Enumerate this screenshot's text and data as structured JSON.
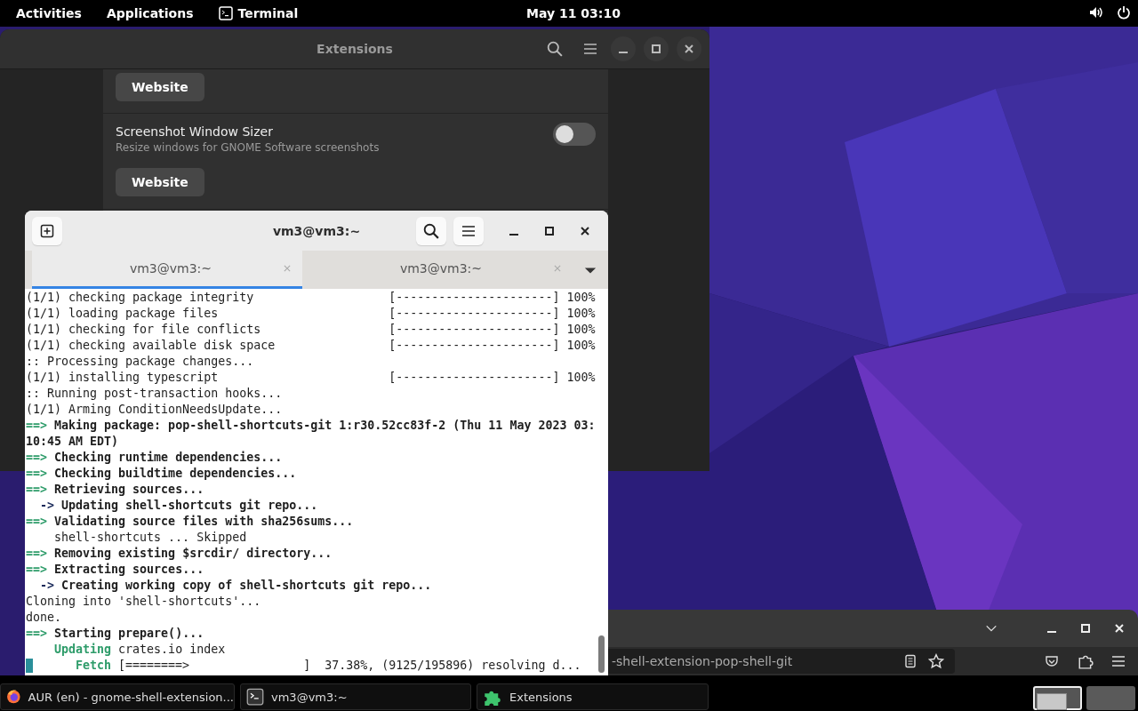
{
  "top_bar": {
    "activities": "Activities",
    "applications": "Applications",
    "app_name": "Terminal",
    "clock": "May 11  03:10"
  },
  "extensions_window": {
    "title": "Extensions",
    "rows": [
      {
        "kind": "partial",
        "button": "Website"
      },
      {
        "kind": "extension",
        "name": "Screenshot Window Sizer",
        "description": "Resize windows for GNOME Software screenshots",
        "on": false,
        "button": "Website"
      }
    ]
  },
  "browser_window": {
    "url": "-shell-extension-pop-shell-git"
  },
  "terminal_window": {
    "title": "vm3@vm3:~",
    "tabs": [
      {
        "label": "vm3@vm3:~",
        "selected": true
      },
      {
        "label": "vm3@vm3:~",
        "selected": false
      }
    ],
    "lines": [
      {
        "kind": "progress",
        "label": "(1/1) checking package integrity",
        "bar": "[----------------------]",
        "percent": "100%"
      },
      {
        "kind": "progress",
        "label": "(1/1) loading package files",
        "bar": "[----------------------]",
        "percent": "100%"
      },
      {
        "kind": "progress",
        "label": "(1/1) checking for file conflicts",
        "bar": "[----------------------]",
        "percent": "100%"
      },
      {
        "kind": "progress",
        "label": "(1/1) checking available disk space",
        "bar": "[----------------------]",
        "percent": "100%"
      },
      {
        "kind": "plain",
        "text": ":: Processing package changes..."
      },
      {
        "kind": "progress",
        "label": "(1/1) installing typescript",
        "bar": "[----------------------]",
        "percent": "100%"
      },
      {
        "kind": "plain",
        "text": ":: Running post-transaction hooks..."
      },
      {
        "kind": "plain",
        "text": "(1/1) Arming ConditionNeedsUpdate..."
      },
      {
        "kind": "step",
        "marker": "==>",
        "text": " Making package: pop-shell-shortcuts-git 1:r30.52cc83f-2 (Thu 11 May 2023 03:"
      },
      {
        "kind": "bold",
        "text": "10:45 AM EDT)"
      },
      {
        "kind": "step",
        "marker": "==>",
        "text": " Checking runtime dependencies..."
      },
      {
        "kind": "step",
        "marker": "==>",
        "text": " Checking buildtime dependencies..."
      },
      {
        "kind": "step",
        "marker": "==>",
        "text": " Retrieving sources..."
      },
      {
        "kind": "substep",
        "marker": "  ->",
        "text": " Updating shell-shortcuts git repo..."
      },
      {
        "kind": "step",
        "marker": "==>",
        "text": " Validating source files with sha256sums..."
      },
      {
        "kind": "plain",
        "text": "    shell-shortcuts ... Skipped"
      },
      {
        "kind": "step",
        "marker": "==>",
        "text": " Removing existing $srcdir/ directory..."
      },
      {
        "kind": "step",
        "marker": "==>",
        "text": " Extracting sources..."
      },
      {
        "kind": "substep",
        "marker": "  ->",
        "text": " Creating working copy of shell-shortcuts git repo..."
      },
      {
        "kind": "plain",
        "text": "Cloning into 'shell-shortcuts'..."
      },
      {
        "kind": "plain",
        "text": "done."
      },
      {
        "kind": "step",
        "marker": "==>",
        "text": " Starting prepare()..."
      },
      {
        "kind": "status",
        "marker": "    Updating",
        "text": " crates.io index"
      },
      {
        "kind": "cursor",
        "marker": "      Fetch",
        "text": " [========>                ]  37.38%, (9125/195896) resolving d..."
      }
    ]
  },
  "taskbar": {
    "items": [
      {
        "kind": "browser",
        "label": "AUR (en) - gnome-shell-extension..."
      },
      {
        "kind": "terminal",
        "label": "vm3@vm3:~"
      },
      {
        "kind": "extensions",
        "label": "Extensions"
      }
    ],
    "workspaces": [
      {
        "selected": true
      },
      {
        "selected": false
      }
    ]
  }
}
